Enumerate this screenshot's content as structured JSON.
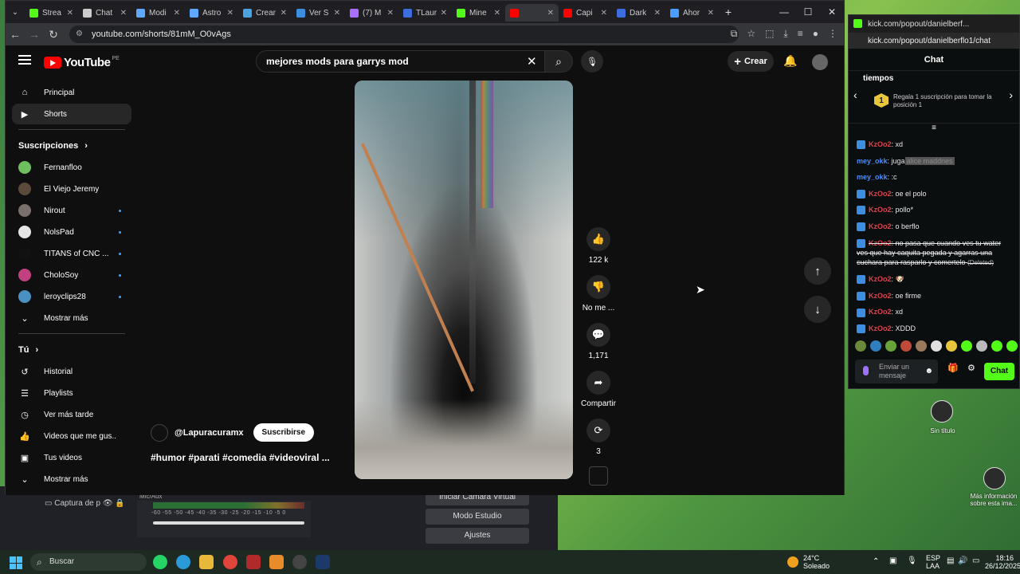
{
  "browser": {
    "tabs": [
      {
        "label": "Strea",
        "color": "#53fc18"
      },
      {
        "label": "Chat",
        "color": "#cccccc"
      },
      {
        "label": "Modi",
        "color": "#5fa8ff"
      },
      {
        "label": "Astro",
        "color": "#5fa8ff"
      },
      {
        "label": "Crear",
        "color": "#4aa3df"
      },
      {
        "label": "Ver S",
        "color": "#3d8ee0"
      },
      {
        "label": "(7) M",
        "color": "#a970ff"
      },
      {
        "label": "TLaur",
        "color": "#3d6ee0"
      },
      {
        "label": "Mine",
        "color": "#53fc18"
      },
      {
        "label": "",
        "color": "#ff0000",
        "active": true
      },
      {
        "label": "Capi",
        "color": "#ff0000"
      },
      {
        "label": "Dark",
        "color": "#3d6ee0"
      },
      {
        "label": "Ahor",
        "color": "#4a9eff"
      }
    ],
    "url": "youtube.com/shorts/81mM_O0vAgs"
  },
  "youtube": {
    "logo_text": "YouTube",
    "logo_region": "PE",
    "search_value": "mejores mods para garrys mod",
    "create_label": "Crear",
    "sidebar": {
      "main": [
        {
          "label": "Principal",
          "icon": "home-icon"
        },
        {
          "label": "Shorts",
          "icon": "shorts-icon",
          "active": true
        }
      ],
      "subs_title": "Suscripciones",
      "subs": [
        {
          "label": "Fernanfloo",
          "color": "#6fbf5f",
          "dot": false
        },
        {
          "label": "El Viejo Jeremy",
          "color": "#5a4a3a",
          "dot": false
        },
        {
          "label": "Nirout",
          "color": "#7a6f6a",
          "dot": true
        },
        {
          "label": "NolsPad",
          "color": "#e5e5e5",
          "dot": true
        },
        {
          "label": "TITANS of CNC ...",
          "color": "#111111",
          "dot": true
        },
        {
          "label": "CholoSoy",
          "color": "#c04080",
          "dot": true
        },
        {
          "label": "leroyclips28",
          "color": "#4a90c0",
          "dot": true
        }
      ],
      "subs_more": "Mostrar más",
      "you_title": "Tú",
      "you": [
        {
          "label": "Historial",
          "icon": "history-icon"
        },
        {
          "label": "Playlists",
          "icon": "playlist-icon"
        },
        {
          "label": "Ver más tarde",
          "icon": "clock-icon"
        },
        {
          "label": "Videos que me gus...",
          "icon": "like-icon"
        },
        {
          "label": "Tus videos",
          "icon": "video-icon"
        }
      ],
      "you_more": "Mostrar más"
    },
    "short": {
      "channel": "@Lapuracuramx",
      "subscribe": "Suscribirse",
      "tags": "#humor #parati #comedia #videoviral ..."
    },
    "actions": {
      "likes": "122 k",
      "dislike": "No me ...",
      "comments": "1,171",
      "share": "Compartir",
      "remix": "3"
    }
  },
  "kick": {
    "window_title": "kick.com/popout/danielberf...",
    "url": "kick.com/popout/danielberflo1/chat",
    "header": "Chat",
    "pinned_title": "tiempos",
    "pinned_rank": "1",
    "pinned_text": "Regala 1 suscripción para tomar la posición 1",
    "messages": [
      {
        "user": "KzOo2",
        "text": ": xd",
        "cls": "u1",
        "icon": true
      },
      {
        "user": "mey_okk",
        "text": ": juga",
        "hl": "alice maddnes",
        "cls": "u2",
        "icon": false
      },
      {
        "user": "mey_okk",
        "text": ": :c",
        "cls": "u2",
        "icon": false
      },
      {
        "user": "KzOo2",
        "text": ": oe el polo",
        "cls": "u1",
        "icon": true
      },
      {
        "user": "KzOo2",
        "text": ": pollo*",
        "cls": "u1",
        "icon": true
      },
      {
        "user": "KzOo2",
        "text": ": o berflo",
        "cls": "u1",
        "icon": true
      },
      {
        "user": "KzOo2",
        "text": ": no pasa que cuando ves tu water ves que hay caquita pegada y agarras una cuchara para rasparlo y comertelo",
        "cls": "u1",
        "icon": true,
        "deleted": "(Deleted)"
      },
      {
        "user": "KzOo2",
        "text": ": 🐶",
        "cls": "u1",
        "icon": true
      },
      {
        "user": "KzOo2",
        "text": ": oe firme",
        "cls": "u1",
        "icon": true
      },
      {
        "user": "KzOo2",
        "text": ": xd",
        "cls": "u1",
        "icon": true
      },
      {
        "user": "KzOo2",
        "text": ": XDDD",
        "cls": "u1",
        "icon": true
      }
    ],
    "input_placeholder": "Enviar un mensaje",
    "chat_button": "Chat"
  },
  "obs": {
    "capture_label": "Captura de p",
    "mixer_label": "Mic/Aux",
    "mixer_ticks": "-60 -55 -50 -45 -40 -35 -30 -25 -20 -15 -10 -5 0",
    "camera_button": "Iniciar Cámara Virtual",
    "studio_button": "Modo Estudio",
    "settings_button": "Ajustes"
  },
  "desktop": {
    "icon1_label": "Sin título",
    "icon2_label": "Más información sobre esta ima..."
  },
  "taskbar": {
    "search_label": "Buscar",
    "weather_temp": "24°C",
    "weather_text": "Soleado",
    "lang": "ESP",
    "layout": "LAA",
    "time": "18:16",
    "date": "26/12/2025"
  }
}
